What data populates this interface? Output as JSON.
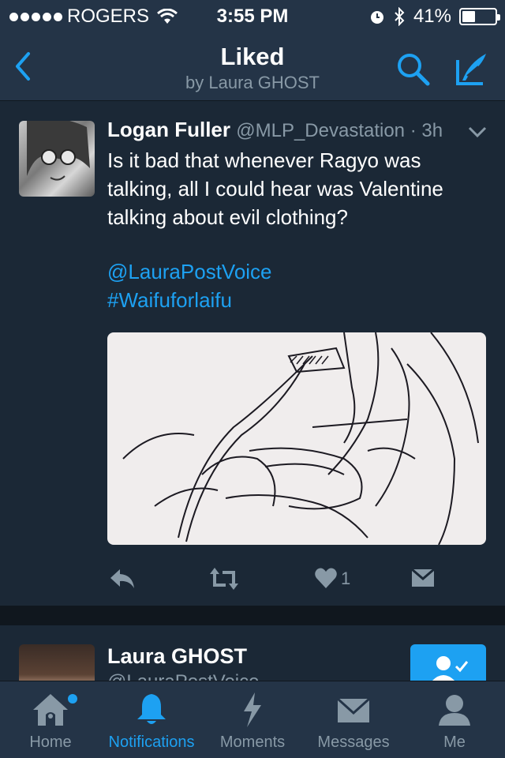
{
  "status_bar": {
    "carrier": "ROGERS",
    "time": "3:55 PM",
    "battery": "41%",
    "battery_level": 0.41
  },
  "nav": {
    "title": "Liked",
    "subtitle": "by Laura GHOST",
    "back_icon": "chevron-left-icon",
    "search_icon": "search-icon",
    "compose_icon": "compose-tweet-icon",
    "accent": "#1da1f2"
  },
  "tweet": {
    "author_name": "Logan Fuller",
    "author_handle": "@MLP_Devastation · 3h",
    "text": "Is it bad that whenever Ragyo was talking, all I could hear was Valentine talking about evil clothing?",
    "mention": "@LauraPostVoice",
    "hashtag": "#Waifuforlaifu",
    "like_count": "1"
  },
  "profile_card": {
    "name": "Laura GHOST",
    "handle": "@LauraPostVoice"
  },
  "tabs": [
    {
      "label": "Home",
      "icon": "home-icon"
    },
    {
      "label": "Notifications",
      "icon": "bell-icon"
    },
    {
      "label": "Moments",
      "icon": "lightning-icon"
    },
    {
      "label": "Messages",
      "icon": "envelope-icon"
    },
    {
      "label": "Me",
      "icon": "person-icon"
    }
  ],
  "active_tab": "Notifications"
}
